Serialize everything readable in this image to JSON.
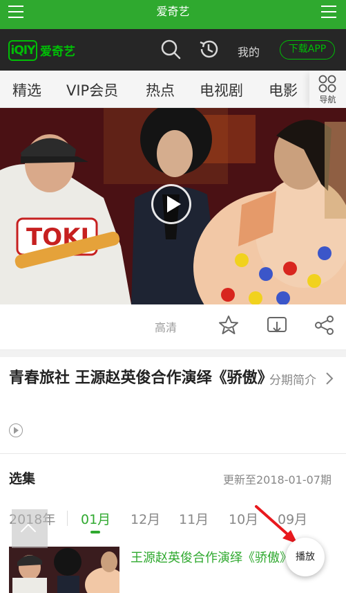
{
  "status_bar": {
    "title": "爱奇艺"
  },
  "header": {
    "logo_mark": "iQIY",
    "logo_text": "爱奇艺",
    "mine_label": "我的",
    "download_label": "下载APP"
  },
  "nav": {
    "items": [
      "精选",
      "VIP会员",
      "热点",
      "电视剧",
      "电影"
    ],
    "more_label": "导航"
  },
  "video": {
    "badge_text": "TOKI",
    "quality_label": "高清"
  },
  "detail": {
    "title": "青春旅社 王源赵英俊合作演绎《骄傲》",
    "intro_label": "分期简介"
  },
  "episodes": {
    "section_label": "选集",
    "updated_text": "更新至2018-01-07期",
    "year_tab": "2018年",
    "month_tabs": [
      "01月",
      "12月",
      "11月",
      "10月",
      "09月"
    ],
    "active_tab": "01月",
    "first_episode_title": "王源赵英俊合作演绎《骄傲》",
    "play_label": "播放"
  },
  "colors": {
    "brand_green": "#2fa92f",
    "logo_green": "#00be06",
    "header_dark": "#262626",
    "annotation_red": "#e8191e"
  }
}
